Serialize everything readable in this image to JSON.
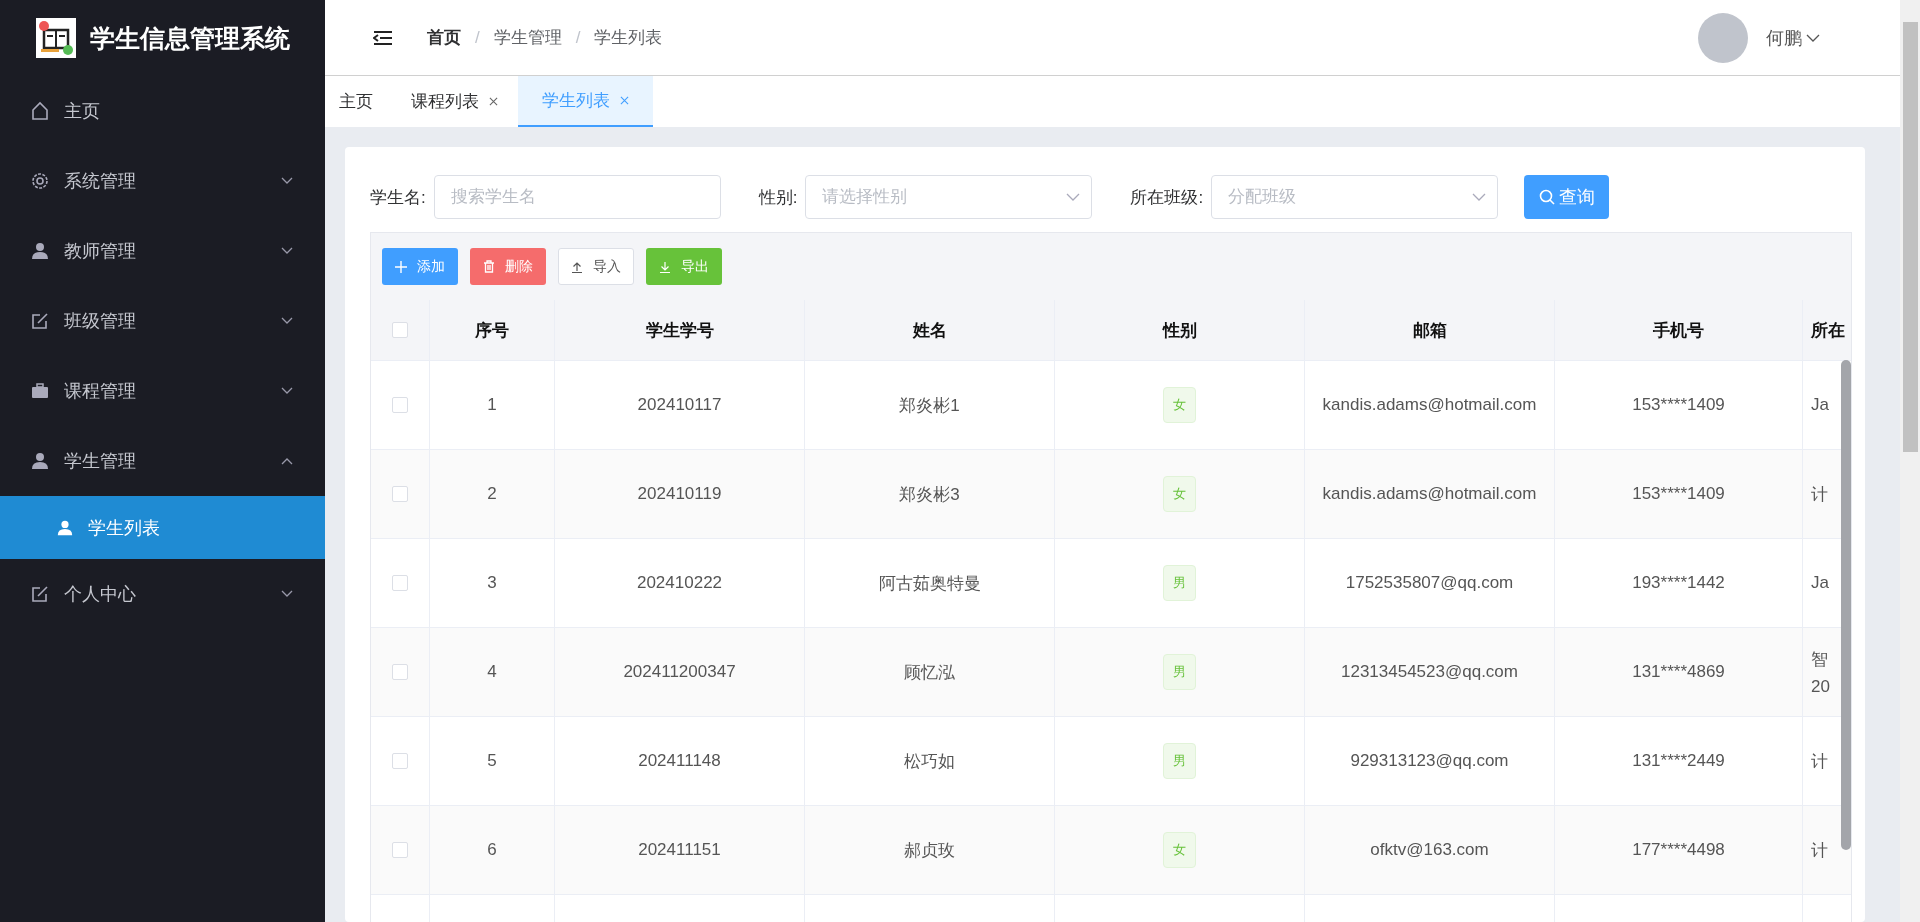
{
  "app": {
    "title": "学生信息管理系统"
  },
  "sidebar": {
    "items": [
      {
        "label": "主页",
        "kind": "link"
      },
      {
        "label": "系统管理",
        "kind": "group",
        "expanded": false
      },
      {
        "label": "教师管理",
        "kind": "group",
        "expanded": false
      },
      {
        "label": "班级管理",
        "kind": "group",
        "expanded": false
      },
      {
        "label": "课程管理",
        "kind": "group",
        "expanded": false
      },
      {
        "label": "学生管理",
        "kind": "group",
        "expanded": true,
        "children": [
          {
            "label": "学生列表",
            "selected": true
          }
        ]
      },
      {
        "label": "个人中心",
        "kind": "group",
        "expanded": false
      }
    ]
  },
  "breadcrumb": [
    "首页",
    "学生管理",
    "学生列表"
  ],
  "breadcrumb_separator": "/",
  "user": {
    "name": "何鹏"
  },
  "tabs": [
    {
      "label": "主页",
      "closable": false,
      "selected": false
    },
    {
      "label": "课程列表",
      "closable": true,
      "selected": false
    },
    {
      "label": "学生列表",
      "closable": true,
      "selected": true
    }
  ],
  "filters": [
    {
      "label": "学生名:",
      "kind": "input",
      "placeholder": "搜索学生名"
    },
    {
      "label": "性别:",
      "kind": "select",
      "placeholder": "请选择性别"
    },
    {
      "label": "所在班级:",
      "kind": "select",
      "placeholder": "分配班级"
    }
  ],
  "search_button": "查询",
  "toolbar": [
    {
      "label": "添加",
      "kind": "add"
    },
    {
      "label": "删除",
      "kind": "delete"
    },
    {
      "label": "导入",
      "kind": "import"
    },
    {
      "label": "导出",
      "kind": "export"
    }
  ],
  "table": {
    "select_all_checked": false,
    "columns": [
      "序号",
      "学生学号",
      "姓名",
      "性别",
      "邮箱",
      "手机号",
      "所在"
    ],
    "rows": [
      {
        "checked": false,
        "cells": [
          "1",
          "202410117",
          "郑炎彬1",
          "女",
          "kandis.adams@hotmail.com",
          "153****1409"
        ],
        "class_lines": [
          "Ja"
        ]
      },
      {
        "checked": false,
        "cells": [
          "2",
          "202410119",
          "郑炎彬3",
          "女",
          "kandis.adams@hotmail.com",
          "153****1409"
        ],
        "class_lines": [
          "计"
        ]
      },
      {
        "checked": false,
        "cells": [
          "3",
          "202410222",
          "阿古茹奥特曼",
          "男",
          "1752535807@qq.com",
          "193****1442"
        ],
        "class_lines": [
          "Ja"
        ]
      },
      {
        "checked": false,
        "cells": [
          "4",
          "202411200347",
          "顾忆泓",
          "男",
          "12313454523@qq.com",
          "131****4869"
        ],
        "class_lines": [
          "智",
          "20"
        ]
      },
      {
        "checked": false,
        "cells": [
          "5",
          "202411148",
          "松巧如",
          "男",
          "929313123@qq.com",
          "131****2449"
        ],
        "class_lines": [
          "计"
        ]
      },
      {
        "checked": false,
        "cells": [
          "6",
          "202411151",
          "郝贞玫",
          "女",
          "ofktv@163.com",
          "177****4498"
        ],
        "class_lines": [
          "计"
        ]
      }
    ]
  }
}
